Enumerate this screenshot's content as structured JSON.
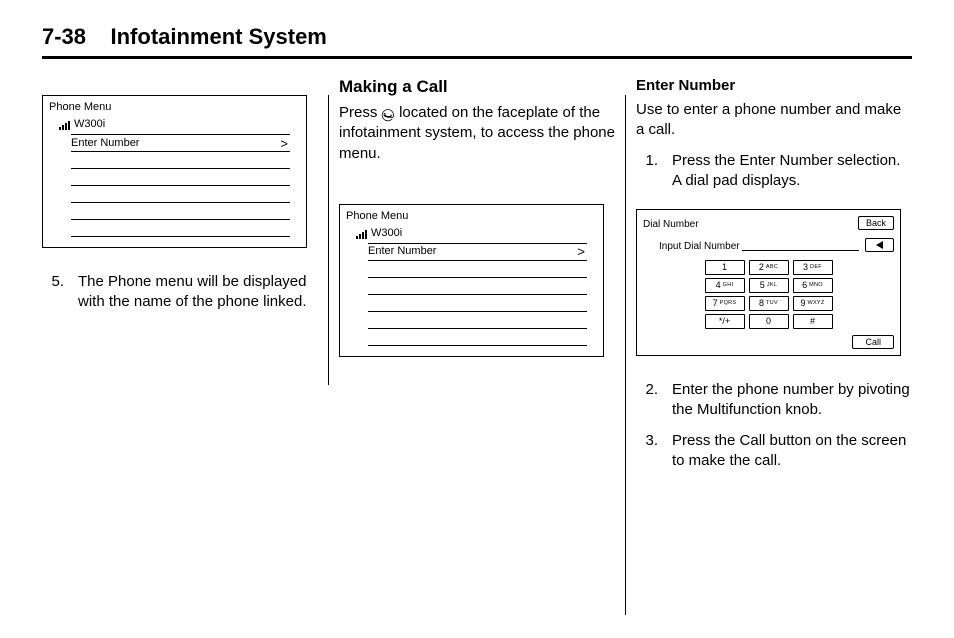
{
  "header": {
    "page_number": "7-38",
    "section_title": "Infotainment System"
  },
  "col1": {
    "figure": {
      "title": "Phone Menu",
      "bt_name": "W300i",
      "enter_number_label": "Enter Number"
    },
    "steps": [
      {
        "n": "5.",
        "text": "The Phone menu will be displayed with the name of the phone linked."
      }
    ]
  },
  "col2": {
    "heading": "Making a Call",
    "para_before": "Press ",
    "para_after": " located on the faceplate of the infotainment system, to access the phone menu.",
    "figure": {
      "title": "Phone Menu",
      "bt_name": "W300i",
      "enter_number_label": "Enter Number"
    }
  },
  "col3": {
    "subheading": "Enter Number",
    "intro": "Use to enter a phone number and make a call.",
    "steps": [
      {
        "n": "1.",
        "text": "Press the Enter Number selection. A dial pad displays."
      },
      {
        "n": "2.",
        "text": "Enter the phone number by pivoting the Multifunction knob."
      },
      {
        "n": "3.",
        "text": "Press the Call button on the screen to make the call."
      }
    ],
    "figure": {
      "title": "Dial Number",
      "back_label": "Back",
      "input_label": "Input Dial Number",
      "call_label": "Call",
      "keys": [
        {
          "d": "1",
          "t": ""
        },
        {
          "d": "2",
          "t": "ABC"
        },
        {
          "d": "3",
          "t": "DEF"
        },
        {
          "d": "4",
          "t": "GHI"
        },
        {
          "d": "5",
          "t": "JKL"
        },
        {
          "d": "6",
          "t": "MNO"
        },
        {
          "d": "7",
          "t": "PQRS"
        },
        {
          "d": "8",
          "t": "TUV"
        },
        {
          "d": "9",
          "t": "WXYZ"
        },
        {
          "d": "*/+",
          "t": ""
        },
        {
          "d": "0",
          "t": ""
        },
        {
          "d": "#",
          "t": ""
        }
      ]
    }
  }
}
